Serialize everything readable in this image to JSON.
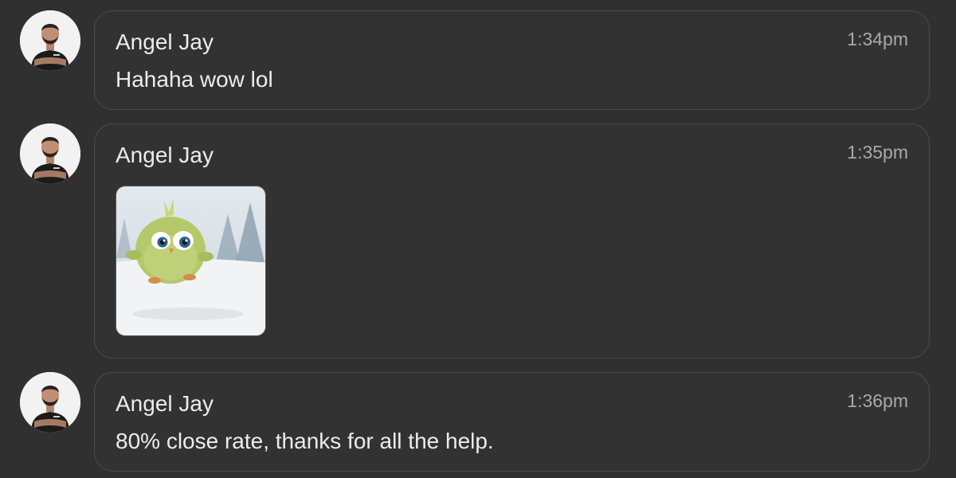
{
  "icons": {
    "avatar": "profile-photo",
    "sticker": "green-bird-sticker"
  },
  "colors": {
    "background": "#303030",
    "card_border": "#4a4a4a",
    "text_primary": "#ececec",
    "text_secondary": "#a9a9a9"
  },
  "messages": [
    {
      "sender": "Angel Jay",
      "time": "1:34pm",
      "text": "Hahaha wow lol"
    },
    {
      "sender": "Angel Jay",
      "time": "1:35pm",
      "attachment": "sticker"
    },
    {
      "sender": "Angel Jay",
      "time": "1:36pm",
      "text": "80% close rate, thanks for all the help."
    }
  ]
}
